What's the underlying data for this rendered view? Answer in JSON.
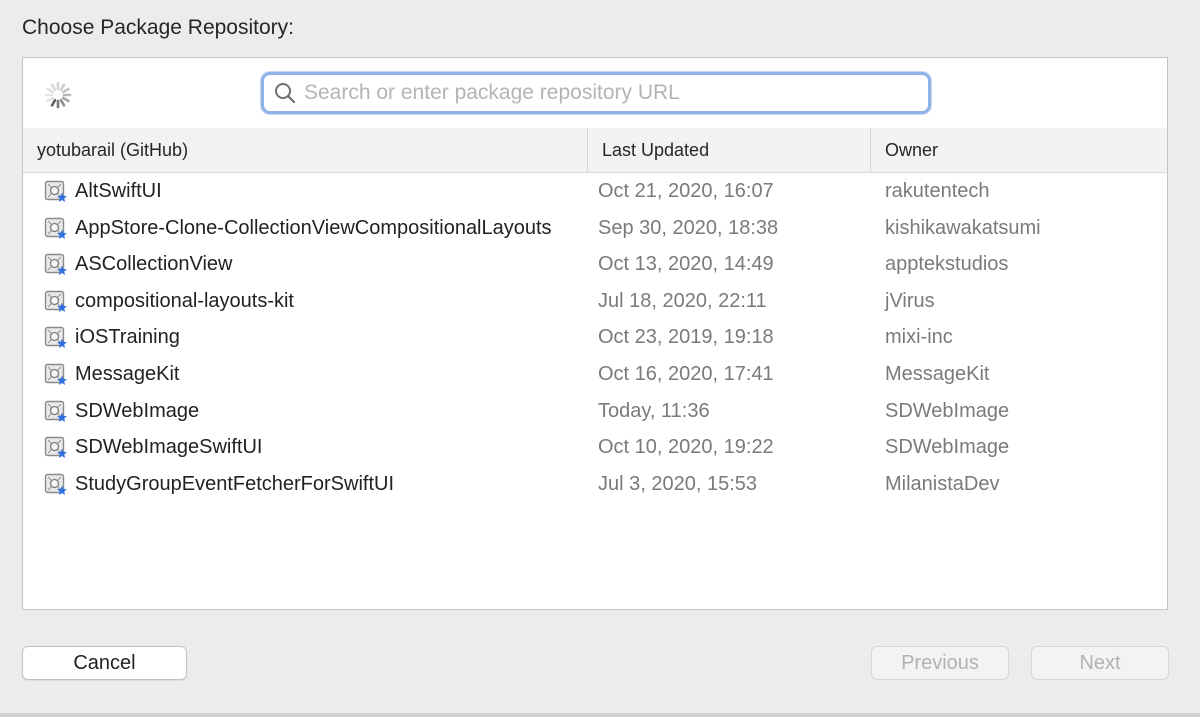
{
  "title": "Choose Package Repository:",
  "search": {
    "placeholder": "Search or enter package repository URL",
    "value": ""
  },
  "columns": {
    "name": "yotubarail (GitHub)",
    "last_updated": "Last Updated",
    "owner": "Owner"
  },
  "rows": [
    {
      "name": "AltSwiftUI",
      "date": "Oct 21, 2020, 16:07",
      "owner": "rakutentech",
      "icon": "swift-package-icon"
    },
    {
      "name": "AppStore-Clone-CollectionViewCompositionalLayouts",
      "date": "Sep 30, 2020, 18:38",
      "owner": "kishikawakatsumi",
      "icon": "swift-package-icon"
    },
    {
      "name": "ASCollectionView",
      "date": "Oct 13, 2020, 14:49",
      "owner": "apptekstudios",
      "icon": "swift-package-icon"
    },
    {
      "name": "compositional-layouts-kit",
      "date": "Jul 18, 2020, 22:11",
      "owner": "jVirus",
      "icon": "swift-package-icon"
    },
    {
      "name": "iOSTraining",
      "date": "Oct 23, 2019, 19:18",
      "owner": "mixi-inc",
      "icon": "swift-package-icon"
    },
    {
      "name": "MessageKit",
      "date": "Oct 16, 2020, 17:41",
      "owner": "MessageKit",
      "icon": "swift-package-icon"
    },
    {
      "name": "SDWebImage",
      "date": "Today, 11:36",
      "owner": "SDWebImage",
      "icon": "swift-package-icon"
    },
    {
      "name": "SDWebImageSwiftUI",
      "date": "Oct 10, 2020, 19:22",
      "owner": "SDWebImage",
      "icon": "swift-package-icon"
    },
    {
      "name": "StudyGroupEventFetcherForSwiftUI",
      "date": "Jul 3, 2020, 15:53",
      "owner": "MilanistaDev",
      "icon": "swift-package-icon"
    }
  ],
  "buttons": {
    "cancel": "Cancel",
    "previous": "Previous",
    "next": "Next"
  },
  "colors": {
    "focus_ring": "#8fb3e8",
    "star_badge": "#2f6fe0",
    "secondary_text": "#7a7a7a"
  }
}
